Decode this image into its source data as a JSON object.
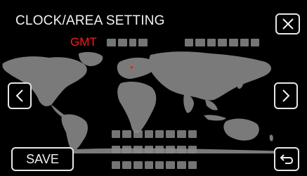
{
  "screen": {
    "title": "CLOCK/AREA SETTING",
    "gmt_label": "GMT",
    "save_label": "SAVE"
  },
  "icons": {
    "close": "close-icon",
    "prev": "chevron-left-icon",
    "next": "chevron-right-icon",
    "back": "return-arrow-icon"
  },
  "colors": {
    "background": "#000000",
    "map": "#7a7a7a",
    "gmt_text": "#ff1a1a",
    "text": "#f2f2f2"
  }
}
